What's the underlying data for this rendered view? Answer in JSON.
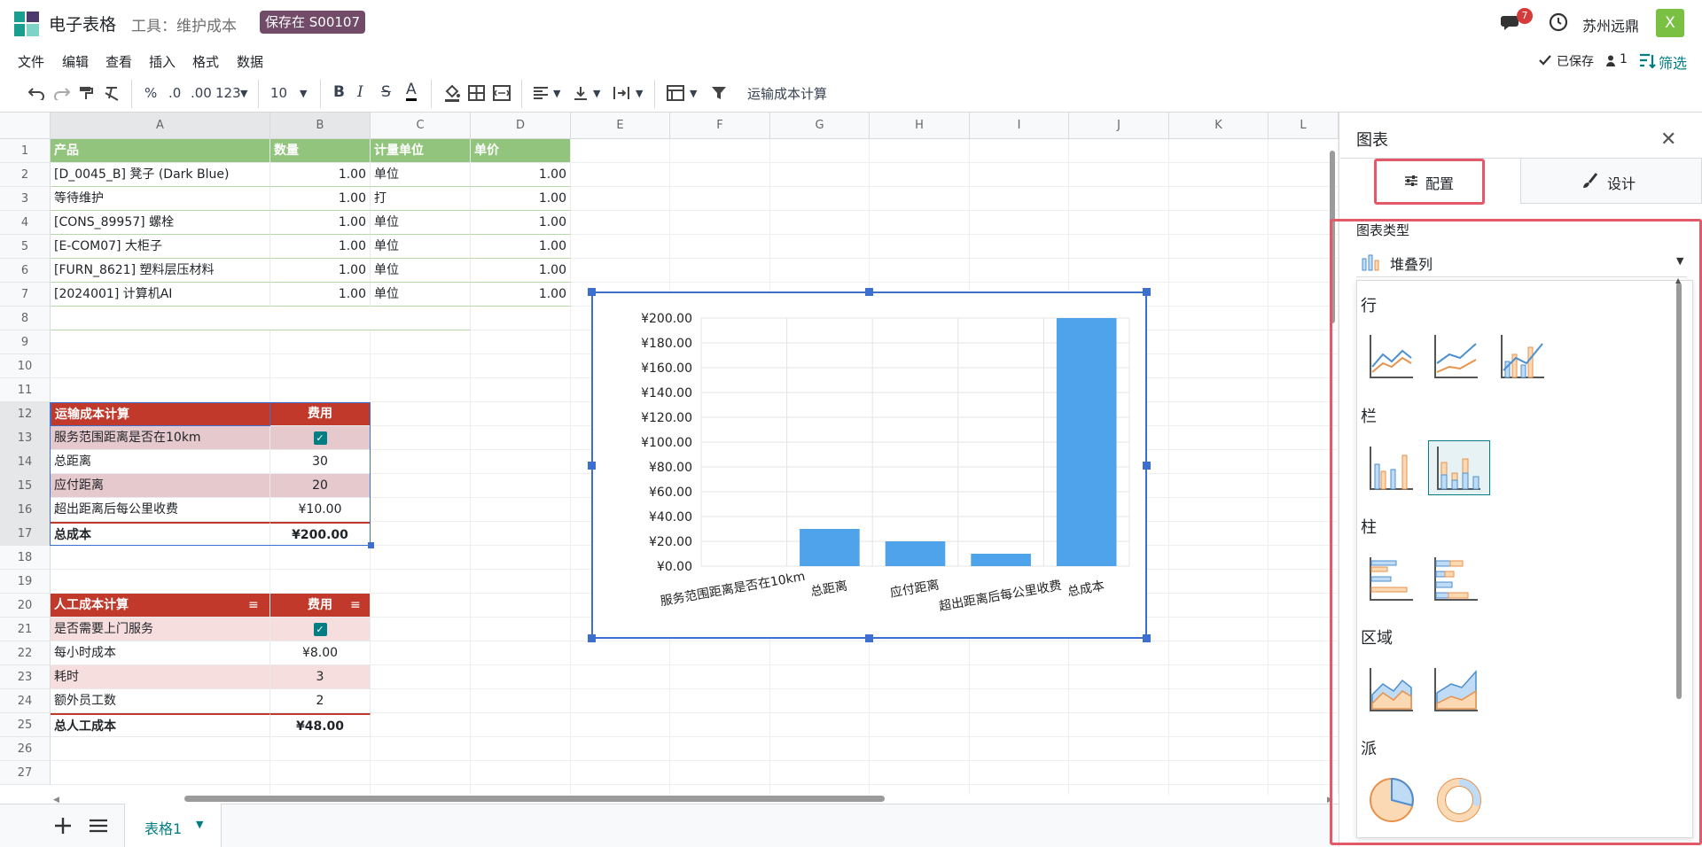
{
  "header": {
    "app_title": "电子表格",
    "doc_name": "工具：维护成本",
    "save_badge": "保存在 S00107",
    "chat_count": "7",
    "company": "苏州远鼎",
    "avatar_letter": "X"
  },
  "menu": [
    "文件",
    "编辑",
    "查看",
    "插入",
    "格式",
    "数据"
  ],
  "status": {
    "saved": "已保存",
    "users": "1",
    "filter": "筛选"
  },
  "toolbar": {
    "percent": "%",
    "dec_less": ".0",
    "dec_more": ".00",
    "format": "123",
    "font_size": "10",
    "bold": "B",
    "italic": "I",
    "strike": "S",
    "text_color": "A",
    "selected_range_name": "运输成本计算"
  },
  "columns": [
    "A",
    "B",
    "C",
    "D",
    "E",
    "F",
    "G",
    "H",
    "I",
    "J",
    "K",
    "L"
  ],
  "rows": [
    "1",
    "2",
    "3",
    "4",
    "5",
    "6",
    "7",
    "8",
    "9",
    "10",
    "11",
    "12",
    "13",
    "14",
    "15",
    "16",
    "17",
    "18",
    "19",
    "20",
    "21",
    "22",
    "23",
    "24",
    "25",
    "26",
    "27"
  ],
  "product_table": {
    "headers": [
      "产品",
      "数量",
      "计量单位",
      "单价"
    ],
    "rows": [
      [
        "[D_0045_B] 凳子 (Dark Blue)",
        "1.00",
        "单位",
        "1.00"
      ],
      [
        "等待维护",
        "1.00",
        "打",
        "1.00"
      ],
      [
        "[CONS_89957] 螺栓",
        "1.00",
        "单位",
        "1.00"
      ],
      [
        "[E-COM07] 大柜子",
        "1.00",
        "单位",
        "1.00"
      ],
      [
        "[FURN_8621] 塑料层压材料",
        "1.00",
        "单位",
        "1.00"
      ],
      [
        "[2024001] 计算机AI",
        "1.00",
        "单位",
        "1.00"
      ]
    ]
  },
  "transport_table": {
    "headers": [
      "运输成本计算",
      "费用"
    ],
    "rows": [
      [
        "服务范围距离是否在10km",
        "checkbox"
      ],
      [
        "总距离",
        "30"
      ],
      [
        "应付距离",
        "20"
      ],
      [
        "超出距离后每公里收费",
        "¥10.00"
      ]
    ],
    "total": [
      "总成本",
      "¥200.00"
    ]
  },
  "labor_table": {
    "headers": [
      "人工成本计算",
      "费用"
    ],
    "rows": [
      [
        "是否需要上门服务",
        "checkbox"
      ],
      [
        "每小时成本",
        "¥8.00"
      ],
      [
        "耗时",
        "3"
      ],
      [
        "额外员工数",
        "2"
      ]
    ],
    "total": [
      "总人工成本",
      "¥48.00"
    ]
  },
  "sheet_tab": "表格1",
  "panel": {
    "title": "图表",
    "tab_config": "配置",
    "tab_design": "设计",
    "chart_type_label": "图表类型",
    "chart_type_value": "堆叠列",
    "categories": [
      "行",
      "栏",
      "柱",
      "区域",
      "派"
    ]
  },
  "chart_data": {
    "type": "bar",
    "categories": [
      "服务范围距离是否在10km",
      "总距离",
      "应付距离",
      "超出距离后每公里收费",
      "总成本"
    ],
    "values": [
      0,
      30,
      20,
      10,
      200
    ],
    "ylim": [
      0,
      200
    ],
    "yticks": [
      "¥0.00",
      "¥20.00",
      "¥40.00",
      "¥60.00",
      "¥80.00",
      "¥100.00",
      "¥120.00",
      "¥140.00",
      "¥160.00",
      "¥180.00",
      "¥200.00"
    ],
    "color": "#4fa3ea",
    "grid": true
  }
}
